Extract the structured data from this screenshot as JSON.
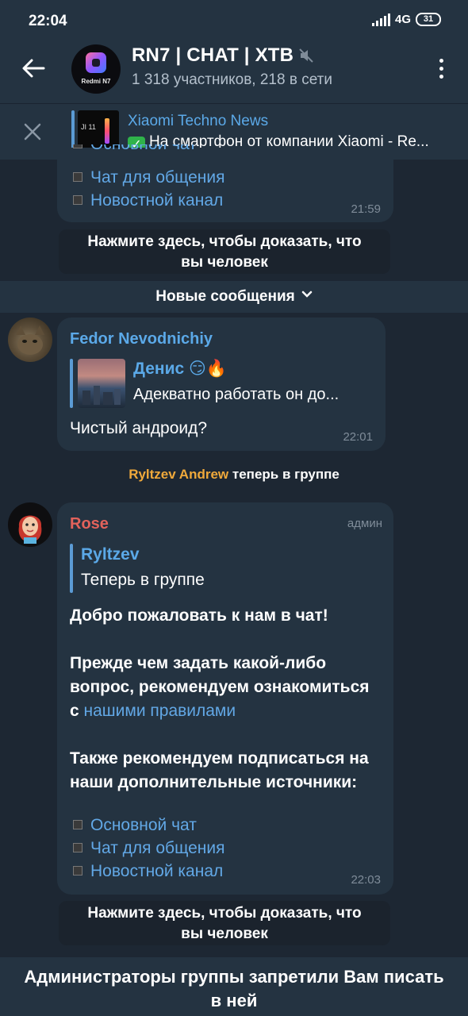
{
  "status": {
    "time": "22:04",
    "network": "4G",
    "battery": "31"
  },
  "header": {
    "title": "RN7 | CHAT | XTB",
    "subtitle": "1 318 участников, 218 в сети",
    "avatar_text": "Redmi N7"
  },
  "pinned": {
    "title": "Xiaomi Techno News",
    "text": "На смартфон от компании Xiaomi - Re...",
    "thumb_text": "JI 11"
  },
  "top_message": {
    "partial_link": "Основной чат",
    "links": [
      "Чат для общения",
      "Новостной канал"
    ],
    "time": "21:59"
  },
  "verify_top": {
    "line1": "Нажмите здесь, чтобы доказать, что",
    "line2": "вы человек"
  },
  "new_messages_label": "Новые сообщения",
  "fedor_message": {
    "sender": "Fedor Nevodnichiy",
    "reply_name": "Денис",
    "reply_emoji": "😏🔥",
    "reply_text": "Адекватно работать он до...",
    "text": "Чистый андроид?",
    "time": "22:01"
  },
  "service": {
    "name": "Ryltzev Andrew",
    "text": "теперь в группе"
  },
  "rose_message": {
    "sender": "Rose",
    "badge": "админ",
    "reply_name": "Ryltzev",
    "reply_text": "Теперь в группе",
    "welcome": "Добро пожаловать к нам в чат!",
    "rules_line1": "Прежде чем задать какой-либо",
    "rules_line2": "вопрос, рекомендуем ознакомиться",
    "rules_prefix": "с",
    "rules_link": "нашими правилами",
    "sub_line1": "Также рекомендуем подписаться на",
    "sub_line2": "наши дополнительные источники:",
    "links": [
      "Основной чат",
      "Чат для общения",
      "Новостной канал"
    ],
    "time": "22:03"
  },
  "verify_bottom": {
    "line1": "Нажмите здесь, чтобы доказать, что",
    "line2": "вы человек"
  },
  "footer": {
    "line1": "Администраторы группы запретили Вам писать",
    "line2": "в ней"
  },
  "colors": {
    "background": "#1d2733",
    "panel": "#243341",
    "link": "#62a8e6",
    "fedor_name": "#5ba9e8",
    "rose_name": "#e2625b",
    "service_name": "#f0a93b"
  }
}
